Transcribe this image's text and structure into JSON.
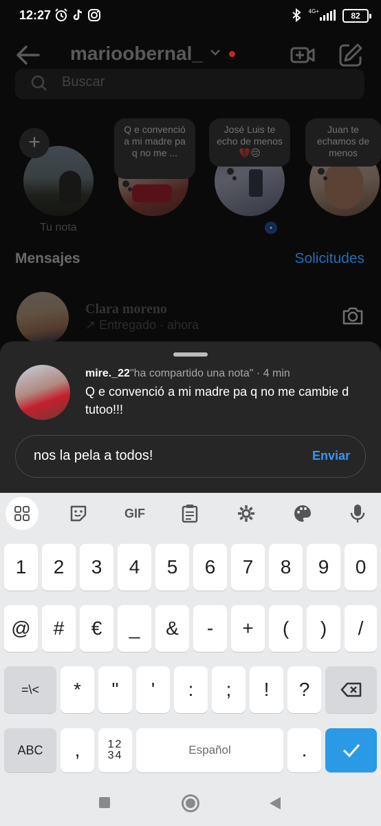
{
  "status_bar": {
    "time": "12:27",
    "network": "4G+",
    "battery": "82"
  },
  "header": {
    "account_name": "marioobernal_",
    "icons": [
      "back-arrow-icon",
      "chevron-down-icon",
      "new-video-call-icon",
      "compose-icon"
    ],
    "unread_dot_color": "#c0262a"
  },
  "search": {
    "placeholder": "Buscar"
  },
  "notes": [
    {
      "text": "",
      "label": "Tu nota"
    },
    {
      "text": "Q e convenció a mi madre pa q no me ..."
    },
    {
      "text": "José Luis te echo de menos 💔😔"
    },
    {
      "text": "Juan te echamos de menos"
    }
  ],
  "messages": {
    "title": "Mensajes",
    "requests": "Solicitudes",
    "conversations": [
      {
        "name": "Clara moreno",
        "status": "↗ Entregado · ahora"
      }
    ]
  },
  "sheet": {
    "username": "mire._22",
    "shared": "\"ha compartido una nota\"",
    "time": "· 4 min",
    "note_text": "Q e convenció a mi madre pa q no me cambie d tutoo!!!",
    "reply_value": "nos la pela a todos!",
    "send_label": "Enviar",
    "accent_color": "#3897f0"
  },
  "keyboard": {
    "toolbar": [
      "apps-grid-icon",
      "sticker-icon",
      "GIF",
      "clipboard-icon",
      "settings-gear-icon",
      "palette-icon",
      "microphone-icon"
    ],
    "gif_label": "GIF",
    "row1": [
      "1",
      "2",
      "3",
      "4",
      "5",
      "6",
      "7",
      "8",
      "9",
      "0"
    ],
    "row2": [
      "@",
      "#",
      "€",
      "_",
      "&",
      "-",
      "+",
      "(",
      ")",
      "/"
    ],
    "row3_left": "=\\<",
    "row3": [
      "*",
      "\"",
      "'",
      ":",
      ";",
      "!",
      "?"
    ],
    "abc": "ABC",
    "comma": ",",
    "frac_top": "12",
    "frac_bottom": "34",
    "space": "Español",
    "period": ".",
    "enter_color": "#2a9ae6"
  }
}
